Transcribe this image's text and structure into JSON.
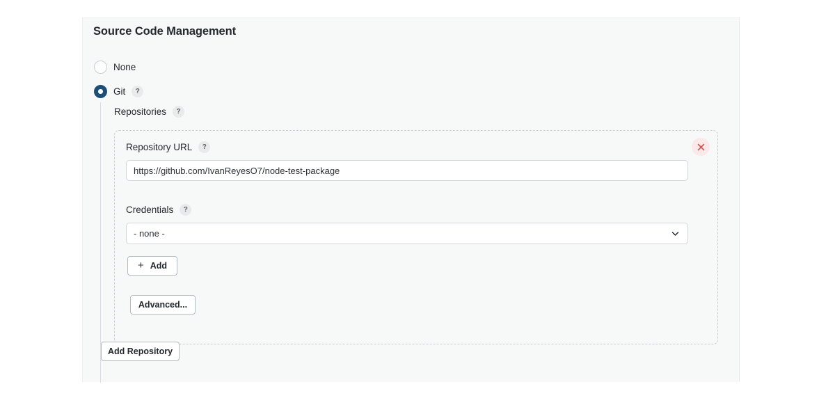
{
  "panel": {
    "title": "Source Code Management",
    "scm_options": [
      {
        "label": "None",
        "selected": false,
        "has_help": false
      },
      {
        "label": "Git",
        "selected": true,
        "has_help": true
      }
    ],
    "repositories_section": {
      "label": "Repositories",
      "help": "?",
      "repository": {
        "url_field": {
          "label": "Repository URL",
          "help": "?",
          "value": "https://github.com/IvanReyesO7/node-test-package",
          "placeholder": ""
        },
        "credentials_field": {
          "label": "Credentials",
          "help": "?",
          "selected_option": "- none -",
          "options": [
            "- none -"
          ]
        },
        "add_button": {
          "label": "Add",
          "icon": "plus-icon"
        },
        "advanced_button": {
          "label": "Advanced..."
        },
        "delete_button": {
          "icon": "close-icon",
          "title": ""
        }
      },
      "add_repository_button": {
        "label": "Add Repository"
      }
    }
  },
  "colors": {
    "accent_selected_radio": "#1c4f77",
    "panel_background": "#f7f8f8",
    "page_background": "#ffffff",
    "delete_badge_background": "#fbe9ea",
    "delete_icon": "#d9534f",
    "dashed_border": "#c8ccd0",
    "text_primary": "#23282e"
  }
}
